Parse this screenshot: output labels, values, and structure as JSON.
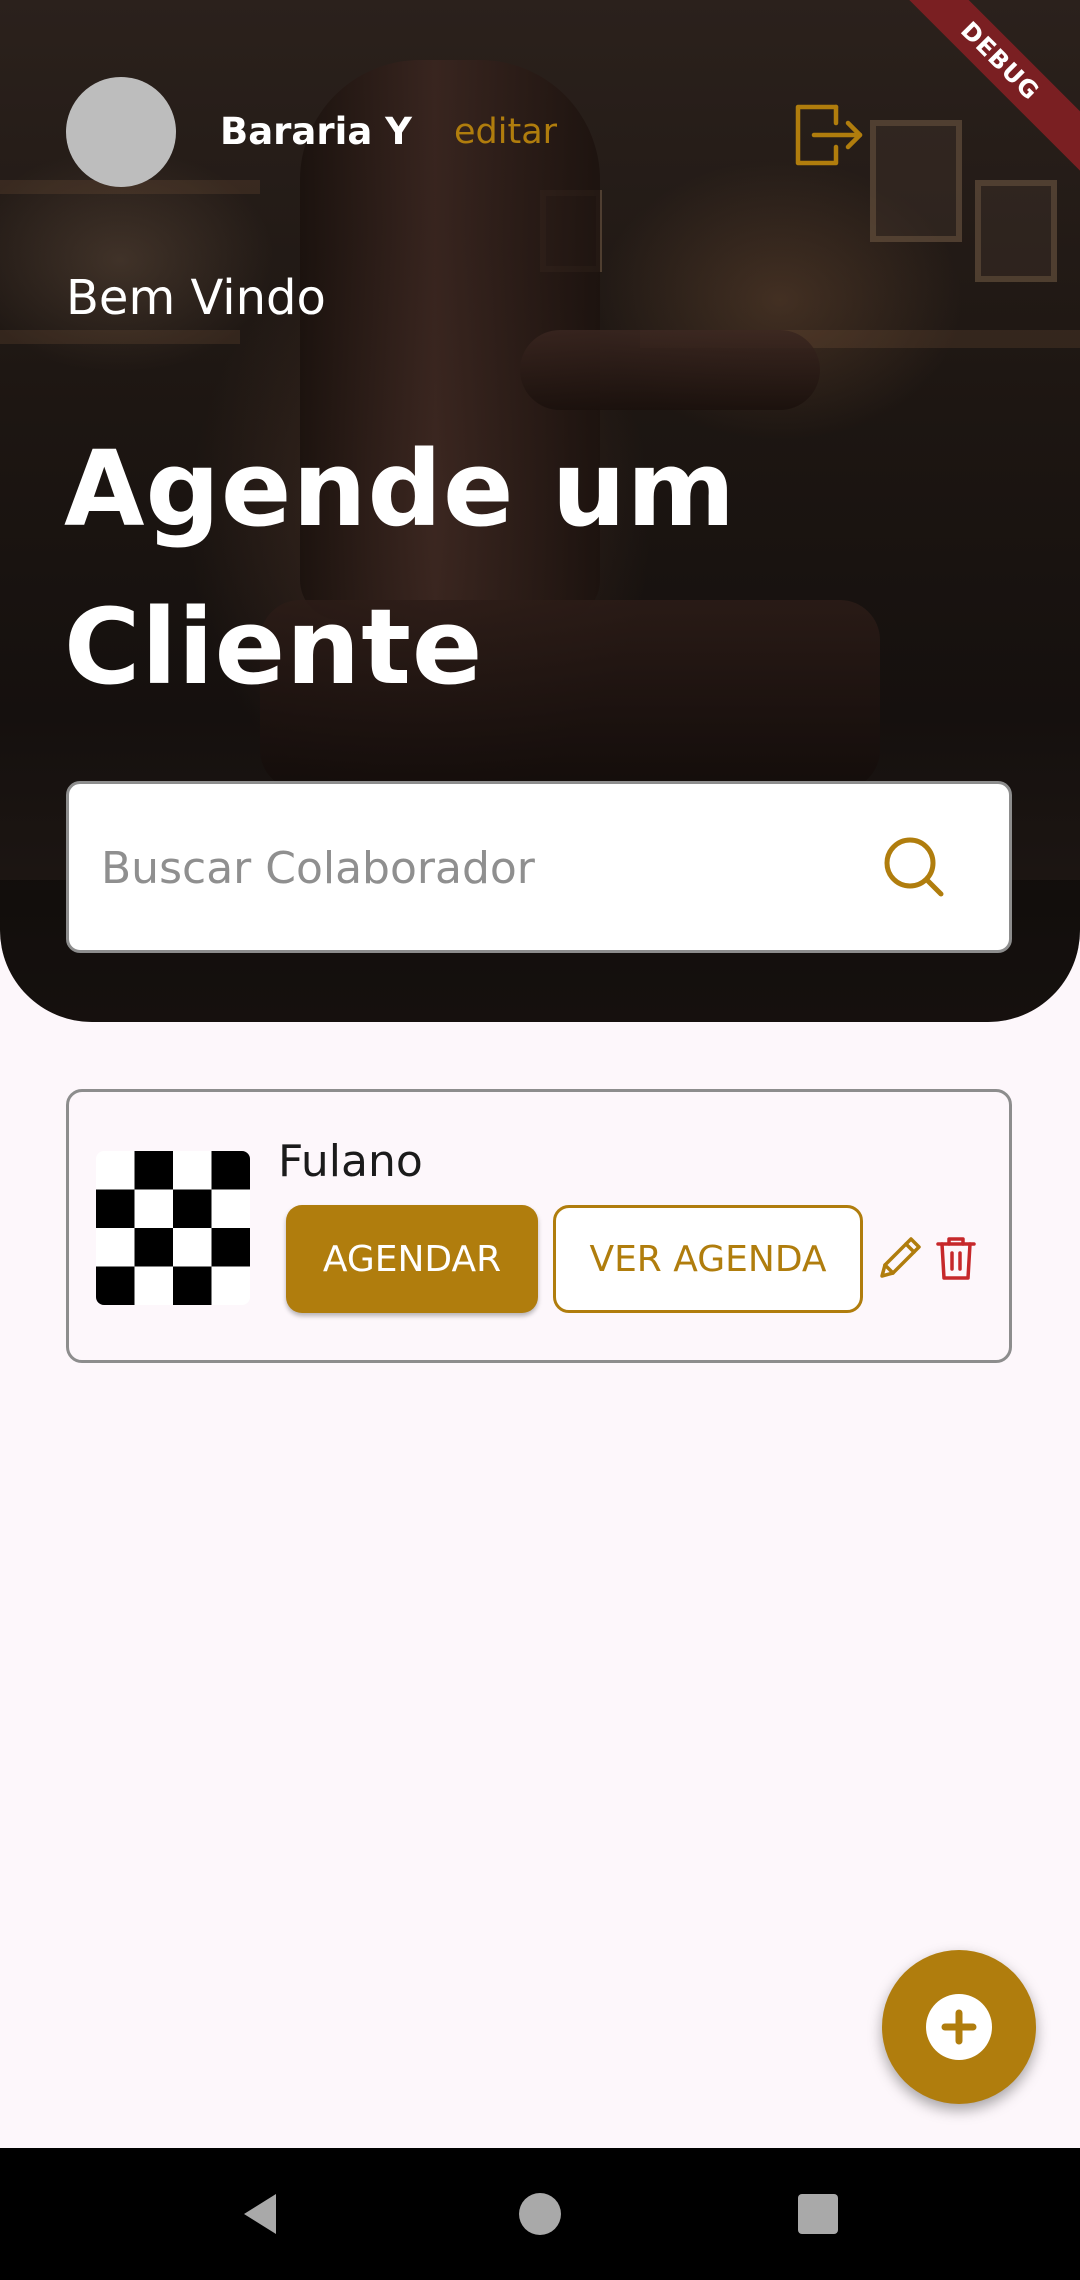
{
  "header": {
    "business_name": "Bararia Y",
    "edit_label": "editar",
    "logout_icon": "logout-icon",
    "debug_banner": "DEBUG"
  },
  "hero": {
    "welcome": "Bem Vindo",
    "headline": "Agende um Cliente"
  },
  "search": {
    "placeholder": "Buscar Colaborador",
    "icon": "search-icon"
  },
  "collaborators": [
    {
      "name": "Fulano",
      "schedule_label": "AGENDAR",
      "view_schedule_label": "VER AGENDA",
      "edit_icon": "pencil-icon",
      "delete_icon": "trash-icon"
    }
  ],
  "fab": {
    "icon": "add-circle-icon"
  },
  "colors": {
    "accent": "#b07d0d",
    "background": "#fdf7fb",
    "delete": "#c6282b",
    "debug_banner": "#7a1f22"
  }
}
